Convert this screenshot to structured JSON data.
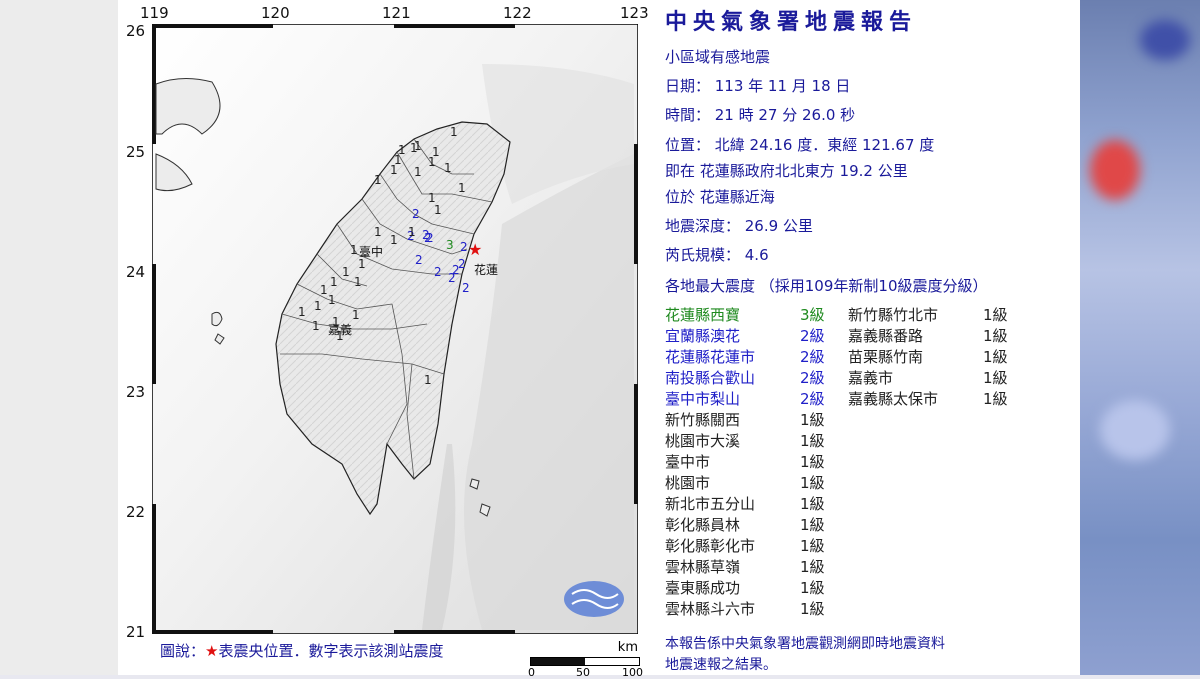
{
  "report": {
    "title": "中央氣象署地震報告",
    "subtitle": "小區域有感地震",
    "date_line": "日期： 113 年 11 月 18 日",
    "time_line": "時間： 21 時 27 分 26.0 秒",
    "position_line": "位置： 北緯 24.16 度．東經 121.67 度",
    "relative_line": "即在 花蓮縣政府北北東方 19.2 公里",
    "located_line": "位於 花蓮縣近海",
    "depth_line": "地震深度： 26.9 公里",
    "magnitude_line": "芮氏規模： 4.6",
    "intensity_header": "各地最大震度 （採用109年新制10級震度分級）",
    "footer_line1": "本報告係中央氣象署地震觀測網即時地震資料",
    "footer_line2": "地震速報之結果。"
  },
  "colors": {
    "title": "#1a1a9a",
    "level3": "#1f8a1f",
    "level2": "#2020c8",
    "level1": "#222222",
    "epicenter": "#e01010"
  },
  "stations_col1": [
    {
      "name": "花蓮縣西寶",
      "intensity": "3級",
      "level": 3
    },
    {
      "name": "宜蘭縣澳花",
      "intensity": "2級",
      "level": 2
    },
    {
      "name": "花蓮縣花蓮市",
      "intensity": "2級",
      "level": 2
    },
    {
      "name": "南投縣合歡山",
      "intensity": "2級",
      "level": 2
    },
    {
      "name": "臺中市梨山",
      "intensity": "2級",
      "level": 2
    },
    {
      "name": "新竹縣關西",
      "intensity": "1級",
      "level": 1
    },
    {
      "name": "桃園市大溪",
      "intensity": "1級",
      "level": 1
    },
    {
      "name": "臺中市",
      "intensity": "1級",
      "level": 1
    },
    {
      "name": "桃園市",
      "intensity": "1級",
      "level": 1
    },
    {
      "name": "新北市五分山",
      "intensity": "1級",
      "level": 1
    },
    {
      "name": "彰化縣員林",
      "intensity": "1級",
      "level": 1
    },
    {
      "name": "彰化縣彰化市",
      "intensity": "1級",
      "level": 1
    },
    {
      "name": "雲林縣草嶺",
      "intensity": "1級",
      "level": 1
    },
    {
      "name": "臺東縣成功",
      "intensity": "1級",
      "level": 1
    },
    {
      "name": "雲林縣斗六市",
      "intensity": "1級",
      "level": 1
    }
  ],
  "stations_col2": [
    {
      "name": "新竹縣竹北市",
      "intensity": "1級",
      "level": 1
    },
    {
      "name": "嘉義縣番路",
      "intensity": "1級",
      "level": 1
    },
    {
      "name": "苗栗縣竹南",
      "intensity": "1級",
      "level": 1
    },
    {
      "name": "嘉義市",
      "intensity": "1級",
      "level": 1
    },
    {
      "name": "嘉義縣太保市",
      "intensity": "1級",
      "level": 1
    }
  ],
  "map": {
    "lon_labels": [
      "119",
      "120",
      "121",
      "122",
      "123"
    ],
    "lat_labels": [
      "26",
      "25",
      "24",
      "23",
      "22",
      "21"
    ],
    "legend_prefix": "圖說：",
    "legend_star": "★",
    "legend_text": "表震央位置．數字表示該測站震度",
    "scale_unit": "km",
    "scale_labels": [
      "0",
      "50",
      "100"
    ],
    "city_labels": {
      "taichung": "臺中",
      "hualien": "花蓮",
      "chiayi": "嘉義"
    },
    "logo_icon": "cwa-logo-icon",
    "intensity_marks": [
      {
        "text": "3",
        "level": 3
      },
      {
        "text": "2",
        "level": 2
      },
      {
        "text": "2",
        "level": 2
      },
      {
        "text": "2",
        "level": 2
      },
      {
        "text": "2",
        "level": 2
      },
      {
        "text": "2",
        "level": 2
      },
      {
        "text": "2",
        "level": 2
      },
      {
        "text": "2",
        "level": 2
      },
      {
        "text": "2",
        "level": 2
      },
      {
        "text": "2",
        "level": 2
      },
      {
        "text": "2",
        "level": 2
      },
      {
        "text": "2",
        "level": 2
      },
      {
        "text": "2",
        "level": 2
      },
      {
        "text": "1",
        "level": 1
      },
      {
        "text": "1",
        "level": 1
      },
      {
        "text": "1",
        "level": 1
      },
      {
        "text": "1",
        "level": 1
      },
      {
        "text": "1",
        "level": 1
      },
      {
        "text": "1",
        "level": 1
      },
      {
        "text": "1",
        "level": 1
      },
      {
        "text": "1",
        "level": 1
      },
      {
        "text": "1",
        "level": 1
      },
      {
        "text": "1",
        "level": 1
      },
      {
        "text": "1",
        "level": 1
      },
      {
        "text": "1",
        "level": 1
      },
      {
        "text": "1",
        "level": 1
      },
      {
        "text": "1",
        "level": 1
      },
      {
        "text": "1",
        "level": 1
      },
      {
        "text": "1",
        "level": 1
      },
      {
        "text": "1",
        "level": 1
      },
      {
        "text": "1",
        "level": 1
      },
      {
        "text": "1",
        "level": 1
      },
      {
        "text": "1",
        "level": 1
      },
      {
        "text": "1",
        "level": 1
      },
      {
        "text": "1",
        "level": 1
      },
      {
        "text": "1",
        "level": 1
      },
      {
        "text": "1",
        "level": 1
      },
      {
        "text": "1",
        "level": 1
      },
      {
        "text": "1",
        "level": 1
      },
      {
        "text": "1",
        "level": 1
      },
      {
        "text": "1",
        "level": 1
      },
      {
        "text": "1",
        "level": 1
      },
      {
        "text": "1",
        "level": 1
      },
      {
        "text": "1",
        "level": 1
      }
    ]
  }
}
